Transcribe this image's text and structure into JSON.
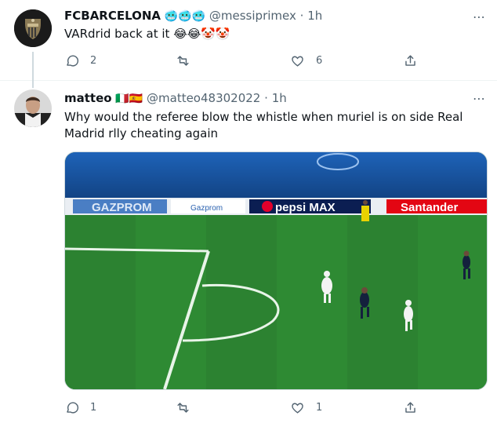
{
  "tweets": [
    {
      "name": "FCBARCELONA",
      "handle": "@messiprimex",
      "separator": "·",
      "time": "1h",
      "name_emoji": "🥶🥶🥶",
      "text": "VARdrid back at it 😂😂🤡🤡",
      "actions": {
        "reply_count": "2",
        "retweet_count": "",
        "like_count": "6"
      }
    },
    {
      "name": "matteo",
      "name_emoji": "🇮🇹🇪🇸",
      "handle": "@matteo48302022",
      "separator": "·",
      "time": "1h",
      "text": "Why would the referee blow the whistle when muriel is on side Real Madrid rlly cheating again",
      "media": {
        "ads": [
          "GAZPROM",
          "Gazprom",
          "pepsi MAX",
          "Santander"
        ]
      },
      "actions": {
        "reply_count": "1",
        "retweet_count": "",
        "like_count": "1"
      }
    }
  ],
  "icons": {
    "more": "more-icon",
    "reply": "reply-icon",
    "retweet": "retweet-icon",
    "like": "like-icon",
    "share": "share-icon"
  },
  "colors": {
    "muted": "#536471",
    "pitch": "#2f7a2f",
    "border": "#eff3f4"
  }
}
